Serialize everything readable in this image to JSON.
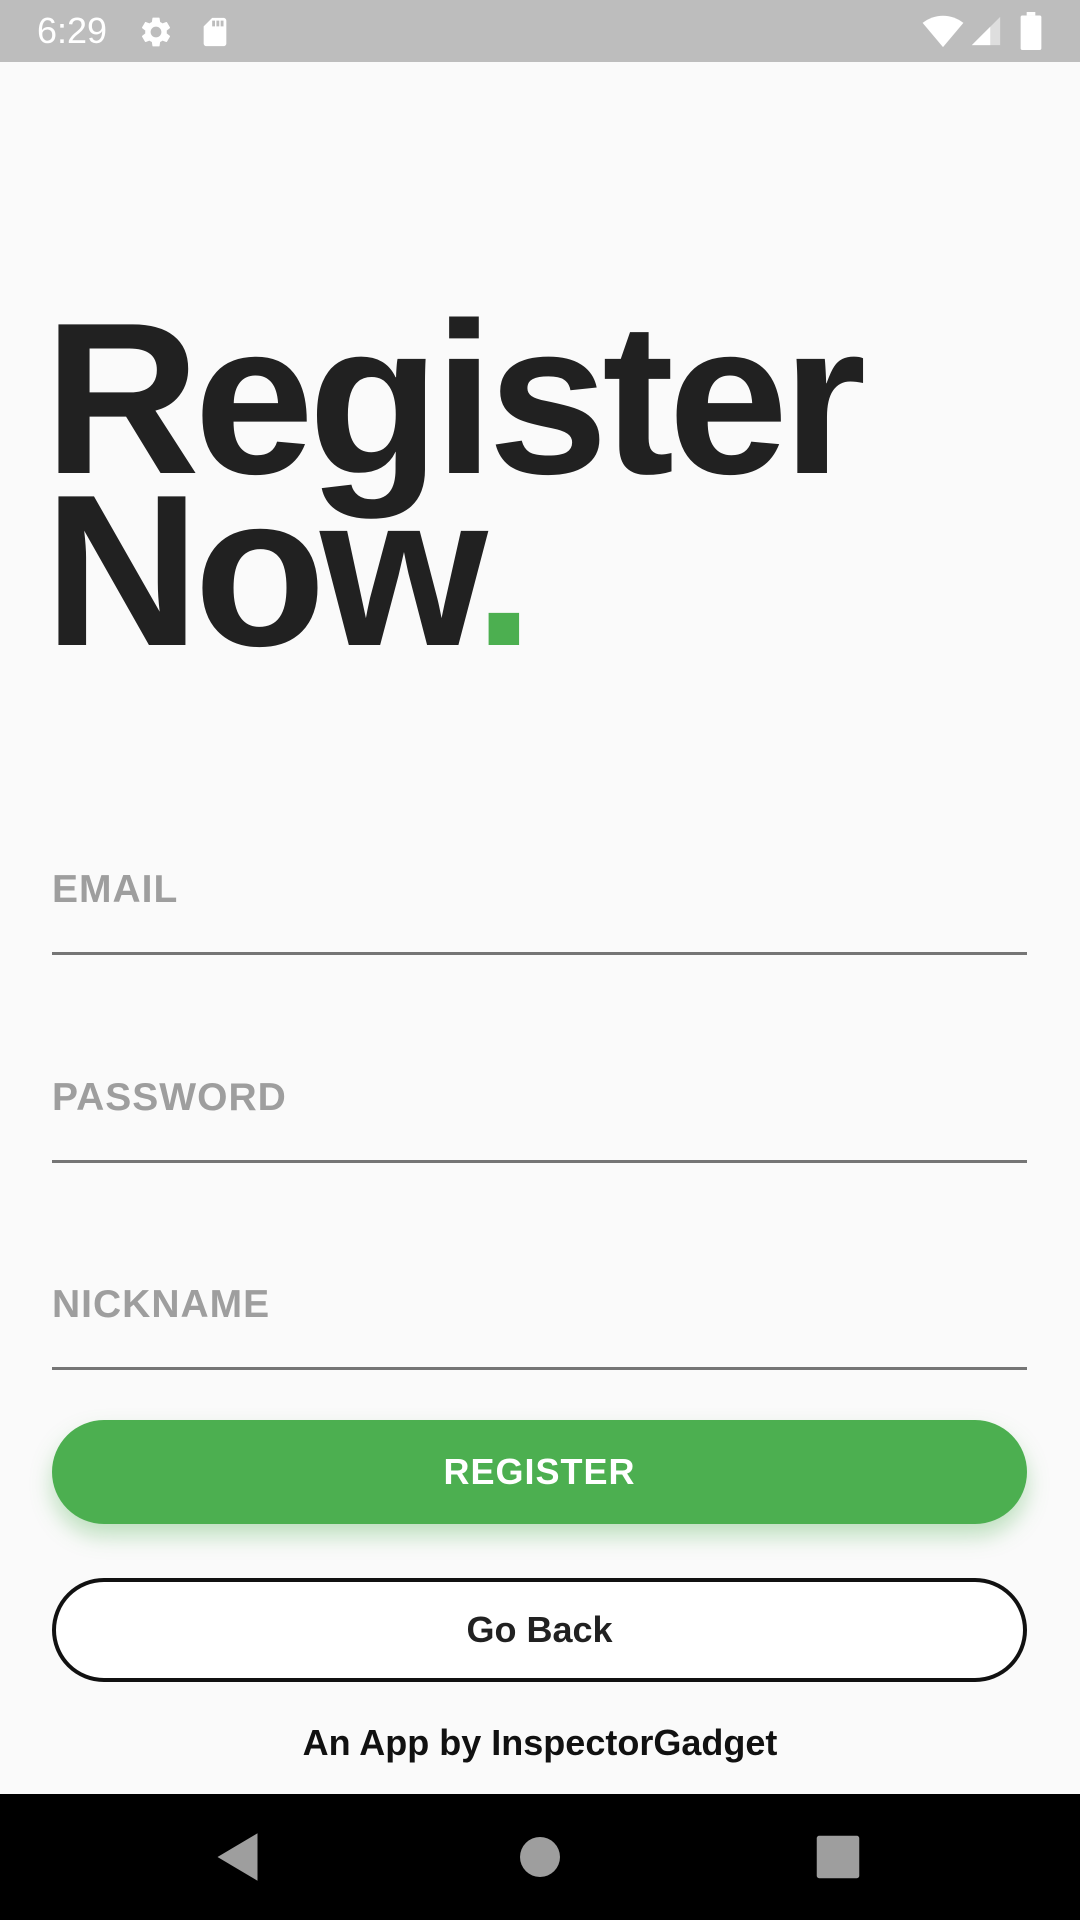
{
  "status_bar": {
    "time": "6:29",
    "left_icons": [
      "gear-icon",
      "sd-card-icon"
    ],
    "right_icons": [
      "wifi-icon",
      "signal-icon",
      "battery-icon"
    ]
  },
  "heading": {
    "line1": "Register",
    "line2": "Now",
    "dot": "."
  },
  "form": {
    "email_placeholder": "EMAIL",
    "email_value": "",
    "password_placeholder": "PASSWORD",
    "password_value": "",
    "nickname_placeholder": "NICKNAME",
    "nickname_value": ""
  },
  "buttons": {
    "register_label": "REGISTER",
    "back_label": "Go Back"
  },
  "footer": {
    "text": "An App by InspectorGadget"
  },
  "nav_bar": {
    "icons": [
      "back-icon",
      "home-icon",
      "recents-icon"
    ]
  },
  "colors": {
    "accent": "#4caf50",
    "text_dark": "#212121",
    "placeholder": "#9e9e9e",
    "status_bar": "#bdbdbd",
    "background": "#fafafa"
  }
}
